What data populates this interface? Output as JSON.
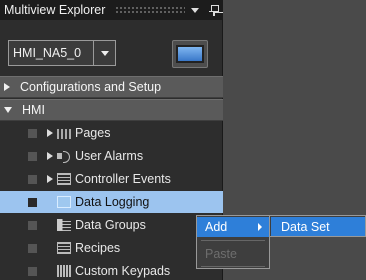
{
  "explorer": {
    "title": "Multiview Explorer",
    "device_name": "HMI_NA5_0"
  },
  "tree": {
    "configurations": "Configurations and Setup",
    "hmi": "HMI",
    "items": [
      {
        "label": "Pages",
        "icon": "pages-icon"
      },
      {
        "label": "User Alarms",
        "icon": "alarm-icon"
      },
      {
        "label": "Controller Events",
        "icon": "events-icon"
      },
      {
        "label": "Data Logging",
        "icon": "data-logging-icon"
      },
      {
        "label": "Data Groups",
        "icon": "data-groups-icon"
      },
      {
        "label": "Recipes",
        "icon": "recipes-icon"
      },
      {
        "label": "Custom Keypads",
        "icon": "keypads-icon"
      }
    ]
  },
  "context_menu": {
    "add": "Add",
    "paste": "Paste"
  },
  "submenu": {
    "data_set": "Data Set"
  },
  "colors": {
    "selection": "#9cc4ef",
    "menu_highlight": "#2e7fd9"
  }
}
